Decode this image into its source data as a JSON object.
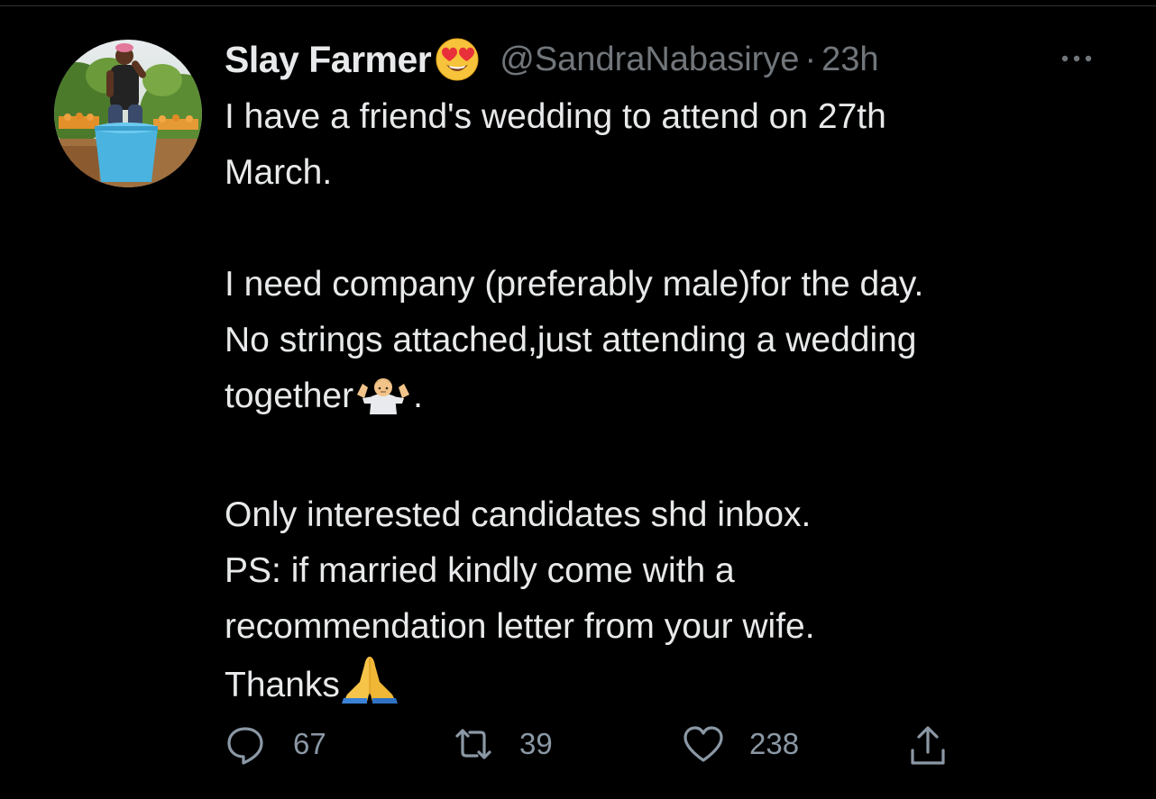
{
  "tweet": {
    "author": {
      "display_name": "Slay Farmer",
      "name_emoji": "smiling-face-with-heart-eyes",
      "handle": "@SandraNabasirye",
      "separator": "·",
      "timestamp": "23h"
    },
    "paragraphs": [
      [
        "I have a friend's wedding to attend on 27th",
        "March."
      ],
      [
        "I need company (preferably male)for the day.",
        "No strings attached,just attending a wedding",
        "together"
      ],
      [
        "Only interested candidates shd inbox.",
        "PS: if married kindly come with a",
        "recommendation letter from your wife.",
        "Thanks"
      ]
    ],
    "together_suffix": ".",
    "emojis": {
      "after_together": "person-shrugging",
      "after_thanks": "folded-hands"
    }
  },
  "actions": {
    "reply_count": "67",
    "retweet_count": "39",
    "like_count": "238"
  },
  "icons": {
    "more": "more-options-icon",
    "reply": "reply-icon",
    "retweet": "retweet-icon",
    "like": "heart-icon",
    "share": "share-icon"
  },
  "colors": {
    "background": "#000000",
    "primary_text": "#e7e9ea",
    "secondary_text": "#71767b",
    "divider": "#2f3336"
  }
}
